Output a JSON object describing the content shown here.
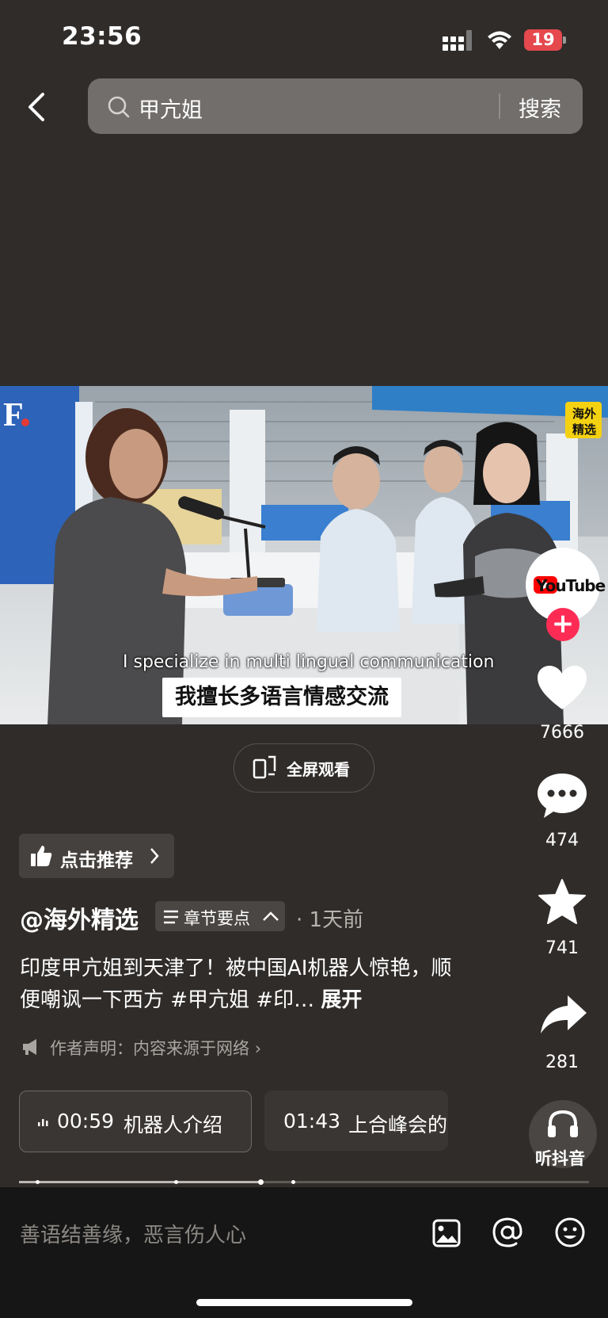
{
  "status_bar": {
    "time": "23:56",
    "battery": "19"
  },
  "search": {
    "query": "甲亢姐",
    "button_label": "搜索"
  },
  "video": {
    "subtitle_en": "I specialize in multi lingual communication",
    "subtitle_cn": "我擅长多语言情感交流",
    "watermark_logo": "F.",
    "channel_badge_line1": "海外",
    "channel_badge_line2": "精选",
    "youtube_label": "YouTube"
  },
  "side_actions": {
    "likes": "7666",
    "comments": "474",
    "favorites": "741",
    "shares": "281",
    "listen_label": "听抖音"
  },
  "fullscreen_label": "全屏观看",
  "recommend_label": "点击推荐",
  "author": "@海外精选",
  "chapter_label": "章节要点",
  "time_ago": "· 1天前",
  "description": "印度甲亢姐到天津了！被中国AI机器人惊艳，顺便嘲讽一下西方 #甲亢姐 #印…",
  "description_more": "展开",
  "disclaimer": "作者声明：内容来源于网络",
  "chapters": [
    {
      "time": "00:59",
      "title": "机器人介绍"
    },
    {
      "time": "01:43",
      "title": "上合峰会的"
    }
  ],
  "comment_placeholder": "善语结善缘，恶言伤人心",
  "colors": {
    "accent_red": "#fe2c55",
    "background": "#2f2c2a",
    "battery_red": "#e5484d"
  }
}
